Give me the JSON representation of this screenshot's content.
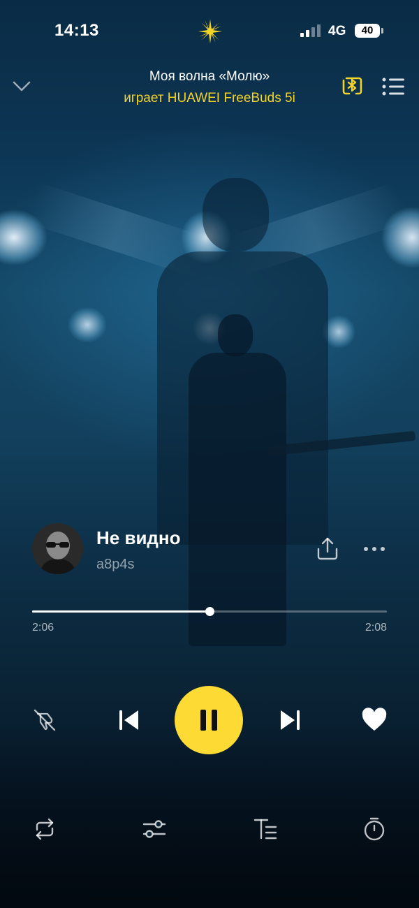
{
  "status_bar": {
    "time": "14:13",
    "network": "4G",
    "battery": "40"
  },
  "header": {
    "title": "Моя волна «Молю»",
    "subtitle": "играет HUAWEI FreeBuds 5i",
    "subtitle_color": "#f5d428"
  },
  "track": {
    "title": "Не видно",
    "artist": "a8p4s"
  },
  "playback": {
    "current_time": "2:06",
    "duration": "2:08",
    "progress_fraction": 0.5,
    "state": "playing"
  },
  "icons": {
    "status": [
      "sun-logo-icon",
      "signal-icon",
      "battery-icon"
    ],
    "header": [
      "chevron-down-icon",
      "bluetooth-output-icon",
      "queue-list-icon"
    ],
    "track": [
      "share-icon",
      "more-icon"
    ],
    "controls": [
      "dislike-icon",
      "previous-icon",
      "pause-icon",
      "next-icon",
      "heart-icon"
    ],
    "bottom": [
      "repeat-icon",
      "equalizer-icon",
      "lyrics-icon",
      "sleep-timer-icon"
    ]
  },
  "colors": {
    "accent": "#fddb34",
    "background": "#0d3756"
  }
}
